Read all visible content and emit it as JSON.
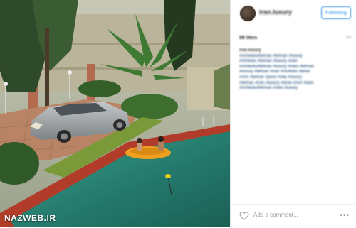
{
  "post": {
    "username": "iran.luxury",
    "follow_label": "Following",
    "likes": "98 likes",
    "time_ago": "2w",
    "caption_lines": [
      "#richkidsoftehran #tehran #luxury",
      "#richkids #tehran #luxury #iran",
      "#richkidsoftehran #luxury #irani #tehran",
      "#luxury #tehran #iran #richkids #bmw",
      "#rich #tehran #pool #villa #luxury",
      "#tehran #iran #luxury #bmw #rich #kids",
      "#richkidsoftehran #villa #luxury"
    ],
    "add_comment_placeholder": "Add a comment...",
    "more_label": "•••"
  },
  "watermark": "NAZWEB.IR",
  "colors": {
    "follow_blue": "#3897f0",
    "hashtag_blue": "#003569",
    "pool_water": "#2f8c7a",
    "car_silver": "#9ea3a6"
  },
  "icons": [
    "heart-icon",
    "more-options-icon"
  ]
}
